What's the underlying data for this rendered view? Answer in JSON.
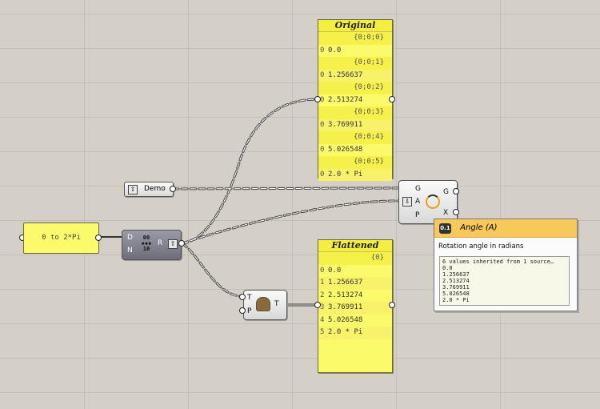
{
  "original_panel": {
    "title": "Original",
    "rows": [
      {
        "path": "{0;0;0}",
        "index": "0",
        "value": "0.0"
      },
      {
        "path": "{0;0;1}",
        "index": "0",
        "value": "1.256637"
      },
      {
        "path": "{0;0;2}",
        "index": "0",
        "value": "2.513274"
      },
      {
        "path": "{0;0;3}",
        "index": "0",
        "value": "3.769911"
      },
      {
        "path": "{0;0;4}",
        "index": "0",
        "value": "5.026548"
      },
      {
        "path": "{0;0;5}",
        "index": "0",
        "value": "2.0 * Pi"
      }
    ]
  },
  "flattened_panel": {
    "title": "Flattened",
    "path": "{0}",
    "rows": [
      {
        "index": "0",
        "value": "0.0"
      },
      {
        "index": "1",
        "value": "1.256637"
      },
      {
        "index": "2",
        "value": "2.513274"
      },
      {
        "index": "3",
        "value": "3.769911"
      },
      {
        "index": "4",
        "value": "5.026548"
      },
      {
        "index": "5",
        "value": "2.0 * Pi"
      }
    ]
  },
  "slider": {
    "label": "0 to 2*Pi"
  },
  "demo_param": {
    "label": "Demo"
  },
  "range_component": {
    "inputs": [
      "D",
      "N"
    ],
    "output": "R"
  },
  "tree_component": {
    "inputs": [
      "T",
      "P"
    ],
    "output": "T"
  },
  "rotate_component": {
    "inputs": [
      "G",
      "A",
      "P"
    ],
    "outputs": [
      "G",
      "X"
    ]
  },
  "tooltip": {
    "badge": "0.1",
    "title": "Angle (A)",
    "description": "Rotation angle in radians",
    "data_lines": [
      "6 values inherited from 1 source…",
      "0.0",
      "1.256637",
      "2.513274",
      "3.769911",
      "5.026548",
      "2.0 * Pi"
    ]
  },
  "colors": {
    "canvas": "#d4d0c8",
    "panel": "#fbfa6a",
    "tooltip_header": "#f7c85a"
  }
}
